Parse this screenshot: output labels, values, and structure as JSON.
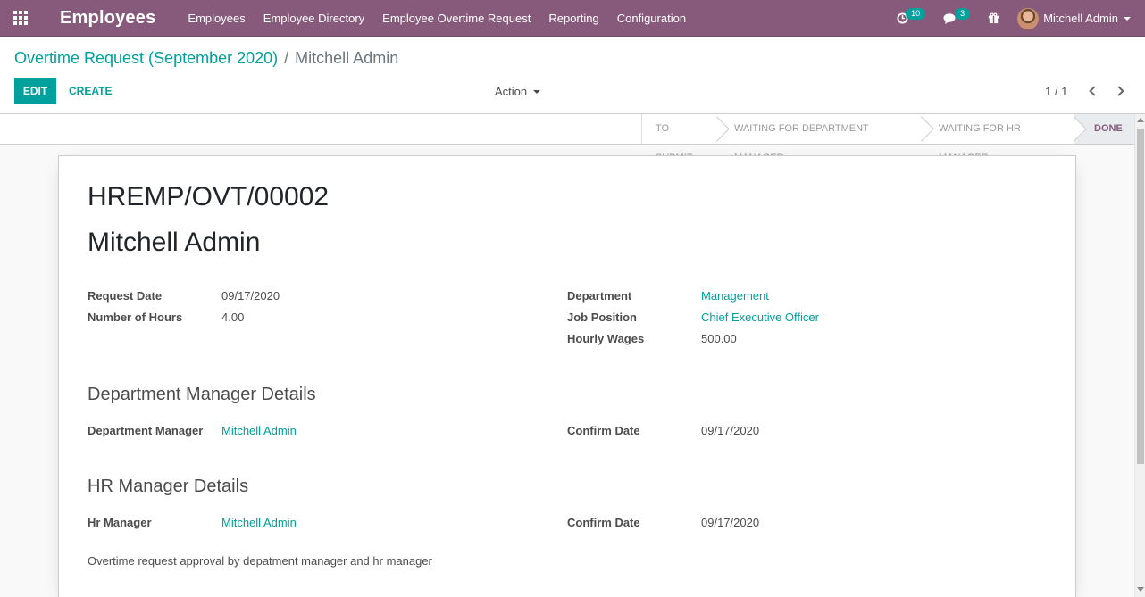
{
  "navbar": {
    "brand": "Employees",
    "menu": [
      "Employees",
      "Employee Directory",
      "Employee Overtime Request",
      "Reporting",
      "Configuration"
    ],
    "activity_count": "10",
    "message_count": "3",
    "user_name": "Mitchell Admin"
  },
  "control_panel": {
    "breadcrumb_parent": "Overtime Request (September 2020)",
    "breadcrumb_sep": "/",
    "breadcrumb_current": "Mitchell Admin",
    "edit_label": "EDIT",
    "create_label": "CREATE",
    "action_label": "Action",
    "pager": "1 / 1"
  },
  "statusbar": {
    "steps": [
      "TO SUBMIT",
      "WAITING FOR DEPARTMENT MANAGER",
      "WAITING FOR HR MANAGER",
      "DONE"
    ],
    "active_step": "DONE"
  },
  "form": {
    "reference": "HREMP/OVT/00002",
    "employee": "Mitchell Admin",
    "request_date_label": "Request Date",
    "request_date": "09/17/2020",
    "hours_label": "Number of Hours",
    "hours": "4.00",
    "department_label": "Department",
    "department": "Management",
    "job_position_label": "Job Position",
    "job_position": "Chief Executive Officer",
    "hourly_wages_label": "Hourly Wages",
    "hourly_wages": "500.00",
    "dept_section_title": "Department Manager Details",
    "dept_manager_label": "Department Manager",
    "dept_manager": "Mitchell Admin",
    "dept_confirm_label": "Confirm Date",
    "dept_confirm_date": "09/17/2020",
    "hr_section_title": "HR Manager Details",
    "hr_manager_label": "Hr Manager",
    "hr_manager": "Mitchell Admin",
    "hr_confirm_label": "Confirm Date",
    "hr_confirm_date": "09/17/2020",
    "note": "Overtime request approval by depatment manager and hr manager"
  },
  "colors": {
    "navbar": "#875a7b",
    "accent": "#00a09d"
  }
}
